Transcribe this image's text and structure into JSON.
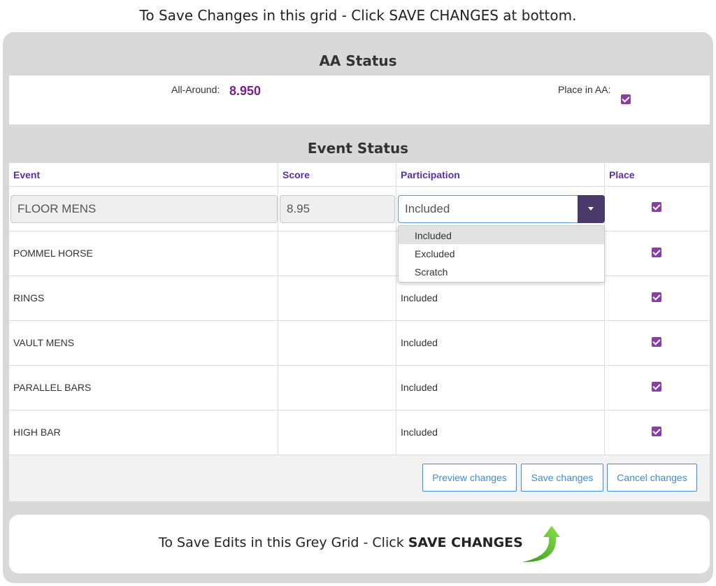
{
  "top_note": "To Save Changes in this grid - Click SAVE CHANGES at bottom.",
  "aa": {
    "title": "AA Status",
    "all_around_label": "All-Around:",
    "all_around_score": "8.950",
    "place_label": "Place in AA:",
    "place_checked": true
  },
  "events": {
    "title": "Event Status",
    "headers": {
      "event": "Event",
      "score": "Score",
      "participation": "Participation",
      "place": "Place"
    },
    "rows": [
      {
        "event": "FLOOR MENS",
        "score": "8.95",
        "participation": "Included",
        "place": true
      },
      {
        "event": "POMMEL HORSE",
        "score": "",
        "participation": "",
        "place": true
      },
      {
        "event": "RINGS",
        "score": "",
        "participation": "Included",
        "place": true
      },
      {
        "event": "VAULT MENS",
        "score": "",
        "participation": "Included",
        "place": true
      },
      {
        "event": "PARALLEL BARS",
        "score": "",
        "participation": "Included",
        "place": true
      },
      {
        "event": "HIGH BAR",
        "score": "",
        "participation": "Included",
        "place": true
      }
    ],
    "dropdown_options": [
      "Included",
      "Excluded",
      "Scratch"
    ],
    "dropdown_selected": "Included"
  },
  "buttons": {
    "preview": "Preview changes",
    "save": "Save changes",
    "cancel": "Cancel changes"
  },
  "bottom_note": {
    "prefix": "To Save Edits in this Grey Grid - Click ",
    "emphasis": "SAVE CHANGES"
  },
  "colors": {
    "accent_purple": "#8a3f9e",
    "header_purple": "#5b2fa6",
    "button_blue": "#3b8ee0",
    "arrow_green": "#5cc324"
  },
  "icons": {
    "checkbox": "checkbox-checked-icon",
    "dropdown": "caret-down-icon",
    "arrow": "curved-arrow-icon"
  }
}
